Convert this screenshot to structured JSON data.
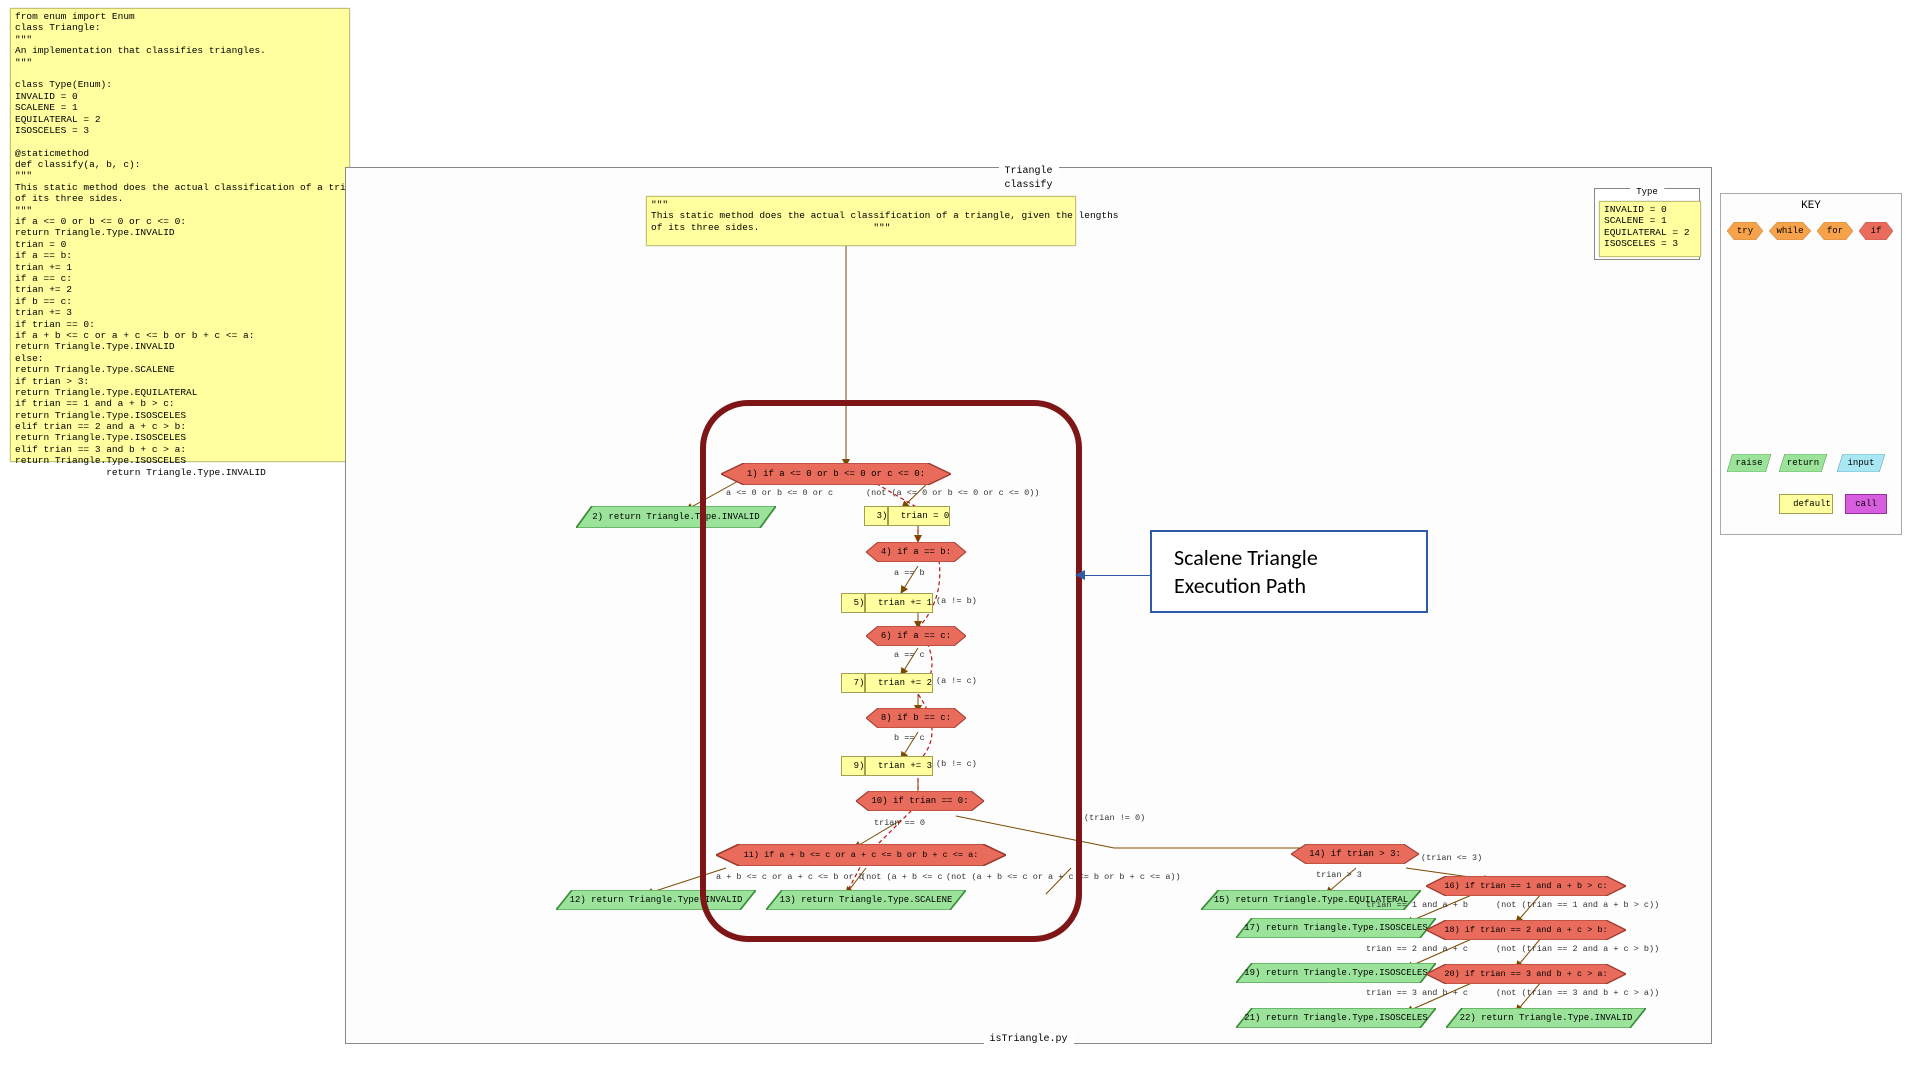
{
  "code_sticky": "from enum import Enum\nclass Triangle:\n\"\"\"\nAn implementation that classifies triangles.\n\"\"\"\n\nclass Type(Enum):\nINVALID = 0\nSCALENE = 1\nEQUILATERAL = 2\nISOSCELES = 3\n\n@staticmethod\ndef classify(a, b, c):\n\"\"\"\nThis static method does the actual classification of a triangle,\nof its three sides.\n\"\"\"\nif a <= 0 or b <= 0 or c <= 0:\nreturn Triangle.Type.INVALID\ntrian = 0\nif a == b:\ntrian += 1\nif a == c:\ntrian += 2\nif b == c:\ntrian += 3\nif trian == 0:\nif a + b <= c or a + c <= b or b + c <= a:\nreturn Triangle.Type.INVALID\nelse:\nreturn Triangle.Type.SCALENE\nif trian > 3:\nreturn Triangle.Type.EQUILATERAL\nif trian == 1 and a + b > c:\nreturn Triangle.Type.ISOSCELES\nelif trian == 2 and a + c > b:\nreturn Triangle.Type.ISOSCELES\nelif trian == 3 and b + c > a:\nreturn Triangle.Type.ISOSCELES\n                return Triangle.Type.INVALID",
  "header_sticky": "\"\"\"\nAn implementation that classifies triangles.\n\"\"\"\nclass Type(Enum):\nINVALID = 0\nSCALENE = 1\nEQUILATERAL = 2\nISOSCELES = 3\n\n            @staticmethod...",
  "classify_doc": "\"\"\"\nThis static method does the actual classification of a triangle, given the lengths\nof its three sides.                    \"\"\"",
  "type_box": "INVALID = 0\nSCALENE = 1\nEQUILATERAL = 2\nISOSCELES = 3",
  "panel": {
    "outer_title": "Triangle",
    "inner_title": "classify",
    "type_title": "Type",
    "bottom_title": "isTriangle.py"
  },
  "callout": {
    "line1": "Scalene Triangle",
    "line2": "Execution Path"
  },
  "key": {
    "title": "KEY",
    "items": {
      "try": "try",
      "while": "while",
      "for": "for",
      "if": "if",
      "raise": "raise",
      "return": "return",
      "input": "input",
      "default": "default",
      "call": "call"
    }
  },
  "nodes": {
    "n1": "1) if a <= 0 or b <= 0 or c <= 0:",
    "n2": "2) return Triangle.Type.INVALID",
    "n3": "3)",
    "n3b": "trian = 0",
    "n4": "4) if a == b:",
    "n5": "5)",
    "n5b": "trian += 1",
    "n5c": "(a != b)",
    "n6": "6) if a == c:",
    "n7": "7)",
    "n7b": "trian += 2",
    "n7c": "(a != c)",
    "n8": "8) if b == c:",
    "n9": "9)",
    "n9b": "trian += 3",
    "n9c": "(b != c)",
    "n10": "10) if trian == 0:",
    "n11": "11) if a + b <= c or a + c <= b or b + c <= a:",
    "n12": "12) return Triangle.Type.INVALID",
    "n13": "13) return Triangle.Type.SCALENE",
    "n14": "14) if trian > 3:",
    "n15": "15) return Triangle.Type.EQUILATERAL",
    "n16": "16) if trian == 1 and a + b > c:",
    "n17": "17) return Triangle.Type.ISOSCELES",
    "n18": "18) if trian == 2 and a + c > b:",
    "n19": "19) return Triangle.Type.ISOSCELES",
    "n20": "20) if trian == 3 and b + c > a:",
    "n21": "21) return Triangle.Type.ISOSCELES",
    "n22": "22) return Triangle.Type.INVALID"
  },
  "edges": {
    "e1_true": "a <= 0 or b <= 0 or c",
    "e1_false": "(not (a <= 0 or b <= 0 or c <= 0))",
    "e4_true": "a == b",
    "e6_true": "a == c",
    "e8_true": "b == c",
    "e10_true": "trian == 0",
    "e10_false": "(trian != 0)",
    "e11_true": "a + b <= c or a + c <= b or b",
    "e11_false": "(not (a + b <= c or a + c <= b or b + c <= a))",
    "e11_comb": "(not (a + b <= c",
    "e14_true": "trian > 3",
    "e14_false": "(trian <= 3)",
    "e16_true": "trian == 1 and a + b",
    "e16_false": "(not (trian == 1 and a + b > c))",
    "e18_true": "trian == 2 and a + c",
    "e18_false": "(not (trian == 2 and a + c > b))",
    "e20_true": "trian == 3 and b + c",
    "e20_false": "(not (trian == 3 and b + c > a))"
  }
}
